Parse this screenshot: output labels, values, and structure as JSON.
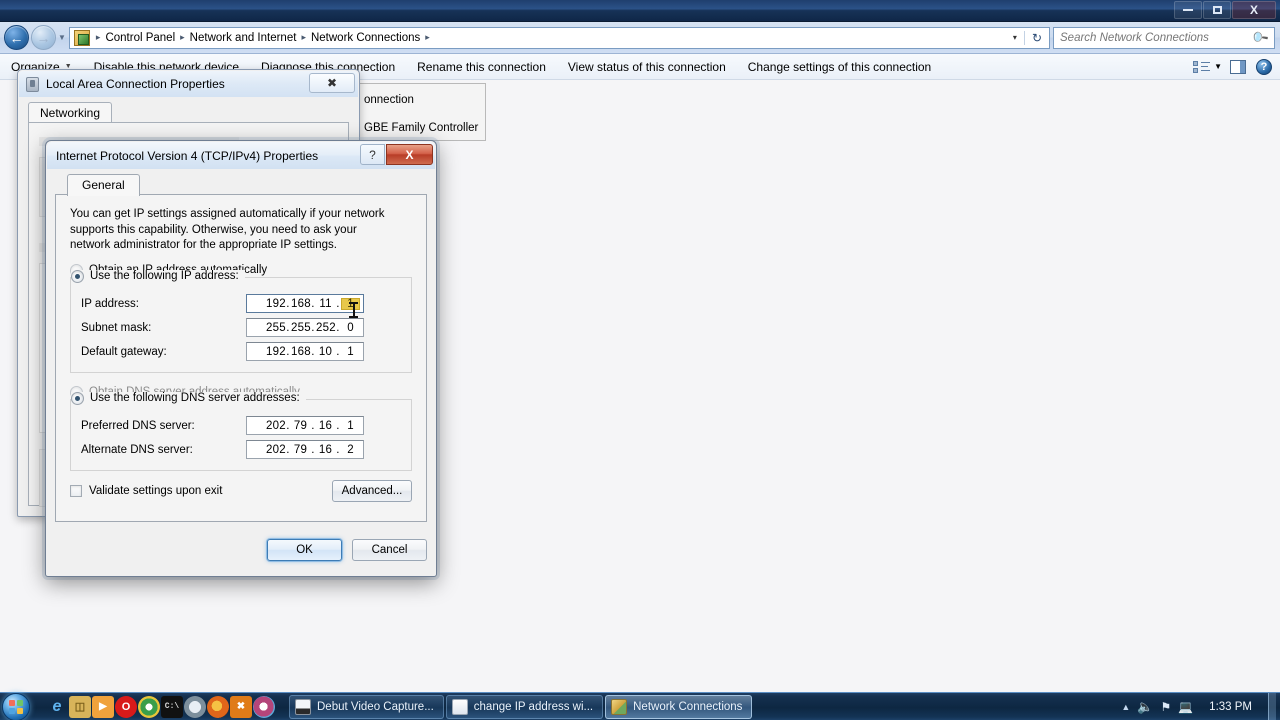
{
  "window": {
    "title": "",
    "minimize_label": "Minimize",
    "restore_label": "Restore",
    "close_label": "X"
  },
  "address_bar": {
    "icon": "control-panel-icon",
    "crumbs": [
      "Control Panel",
      "Network and Internet",
      "Network Connections"
    ],
    "separator": "▸",
    "dropdown": "▾",
    "refresh": "↻"
  },
  "search": {
    "placeholder": "Search Network Connections",
    "icon": "search-icon"
  },
  "command_bar": {
    "organize": "Organize",
    "organize_caret": "▼",
    "items": [
      "Disable this network device",
      "Diagnose this connection",
      "Rename this connection",
      "View status of this connection",
      "Change settings of this connection"
    ],
    "view_caret": "▼",
    "help": "?"
  },
  "tooltip_fragment": {
    "line1": "onnection",
    "line2": "GBE Family Controller"
  },
  "lac_dialog": {
    "title": "Local Area Connection Properties",
    "close": "✖",
    "tab": "Networking"
  },
  "ipv4_dialog": {
    "title": "Internet Protocol Version 4 (TCP/IPv4) Properties",
    "help_btn": "?",
    "close_btn": "X",
    "tab": "General",
    "intro": "You can get IP settings assigned automatically if your network supports this capability. Otherwise, you need to ask your network administrator for the appropriate IP settings.",
    "radio_dhcp_ip": "Obtain an IP address automatically",
    "radio_static_ip": "Use the following IP address:",
    "ip_label": "IP address:",
    "ip_value": [
      "192",
      "168",
      "11",
      "1"
    ],
    "ip_selected_octet_index": 3,
    "subnet_label": "Subnet mask:",
    "subnet_value": [
      "255",
      "255",
      "252",
      "0"
    ],
    "gateway_label": "Default gateway:",
    "gateway_value": [
      "192",
      "168",
      "10",
      "1"
    ],
    "radio_dhcp_dns": "Obtain DNS server address automatically",
    "radio_static_dns": "Use the following DNS server addresses:",
    "preferred_dns_label": "Preferred DNS server:",
    "preferred_dns_value": [
      "202",
      "79",
      "16",
      "1"
    ],
    "alternate_dns_label": "Alternate DNS server:",
    "alternate_dns_value": [
      "202",
      "79",
      "16",
      "2"
    ],
    "validate_label": "Validate settings upon exit",
    "validate_checked": false,
    "advanced_btn": "Advanced...",
    "ok_btn": "OK",
    "cancel_btn": "Cancel",
    "dot": "."
  },
  "taskbar": {
    "start": "start-orb",
    "quick_launch": [
      {
        "name": "internet-explorer-icon",
        "glyph": "e",
        "color": "#2f86d6"
      },
      {
        "name": "windows-explorer-icon",
        "glyph": "▤",
        "color": "#d8b45a"
      },
      {
        "name": "media-player-icon",
        "glyph": "▶",
        "color": "#e8870f"
      },
      {
        "name": "opera-icon",
        "glyph": "O",
        "color": "#d81a1a"
      },
      {
        "name": "chrome-icon",
        "glyph": "●",
        "color": "#3a9e4a"
      },
      {
        "name": "command-prompt-icon",
        "glyph": "C:\\",
        "color": "#111111"
      },
      {
        "name": "safari-icon",
        "glyph": "◑",
        "color": "#7d8f9c"
      },
      {
        "name": "firefox-icon",
        "glyph": "◕",
        "color": "#e0661a"
      },
      {
        "name": "maxthon-icon",
        "glyph": "✖",
        "color": "#e07b18"
      },
      {
        "name": "browser-icon",
        "glyph": "◔",
        "color": "#b4457a"
      }
    ],
    "buttons": [
      {
        "label": "Debut Video Capture...",
        "icon": "debut-video-capture-icon",
        "color": "#e9edf2",
        "active": false
      },
      {
        "label": "change IP address wi...",
        "icon": "document-icon",
        "color": "#dbe5f0",
        "active": false
      },
      {
        "label": "Network Connections",
        "icon": "network-connections-icon",
        "color": "#d9c88a",
        "active": true
      }
    ],
    "tray": {
      "show_hidden": "▲",
      "volume": "volume-icon",
      "action_center": "flag-icon",
      "network": "network-icon",
      "clock": "1:33 PM"
    }
  }
}
